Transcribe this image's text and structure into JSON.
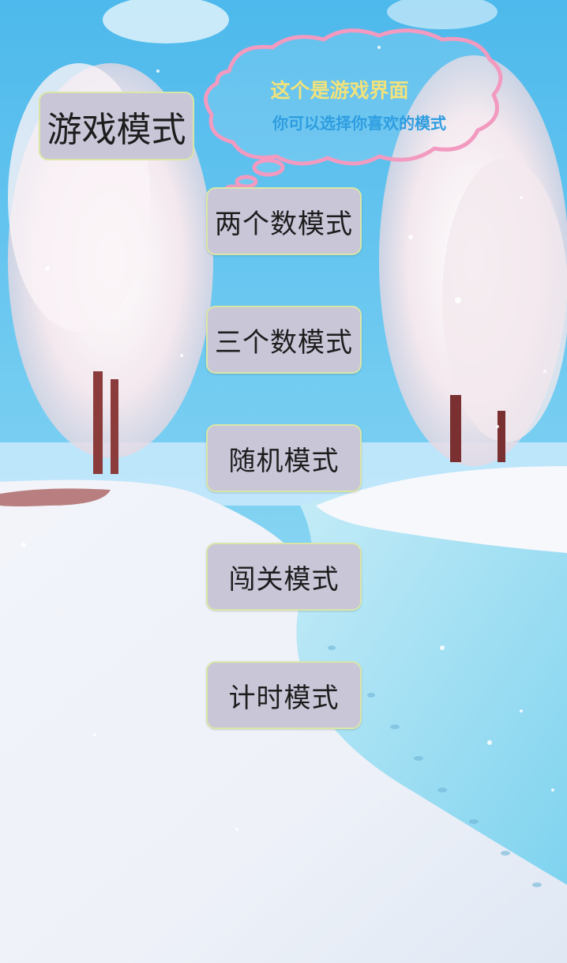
{
  "title": "游戏模式",
  "bubble": {
    "line1": "这个是游戏界面",
    "line2": "你可以选择你喜欢的模式"
  },
  "modes": [
    {
      "label": "两个数模式"
    },
    {
      "label": "三个数模式"
    },
    {
      "label": "随机模式"
    },
    {
      "label": "闯关模式"
    },
    {
      "label": "计时模式"
    }
  ],
  "colors": {
    "button_bg": "#c9c6d8",
    "button_border": "#d9e6a8",
    "bubble_outline": "#f29ac0",
    "bubble_line1": "#f2e27a",
    "bubble_line2": "#2e9de0",
    "sky": "#5cc1ee",
    "snow": "#f4f6fb"
  }
}
